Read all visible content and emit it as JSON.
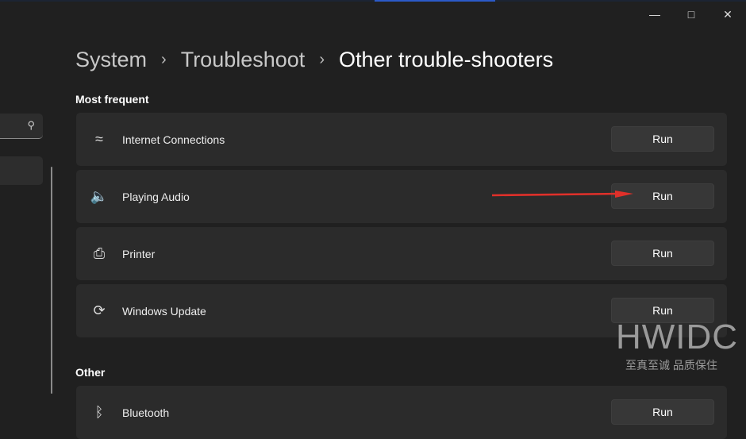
{
  "window": {
    "minimize_icon": "minimize-icon",
    "maximize_icon": "maximize-icon",
    "close_icon": "close-icon"
  },
  "breadcrumb": [
    "System",
    "Troubleshoot",
    "Other trouble-shooters"
  ],
  "sections": {
    "most_frequent": "Most frequent",
    "other": "Other"
  },
  "items": [
    {
      "label": "Internet Connections",
      "icon": "wifi-ethernet-icon",
      "button": "Run"
    },
    {
      "label": "Playing Audio",
      "icon": "speaker-icon",
      "button": "Run"
    },
    {
      "label": "Printer",
      "icon": "printer-icon",
      "button": "Run"
    },
    {
      "label": "Windows Update",
      "icon": "refresh-icon",
      "button": "Run"
    },
    {
      "label": "Bluetooth",
      "icon": "bluetooth-icon",
      "button": "Run"
    }
  ],
  "annotation": {
    "color": "#e0302a"
  },
  "watermark": {
    "title": "HWIDC",
    "subtitle": "至真至诚 品质保住"
  }
}
